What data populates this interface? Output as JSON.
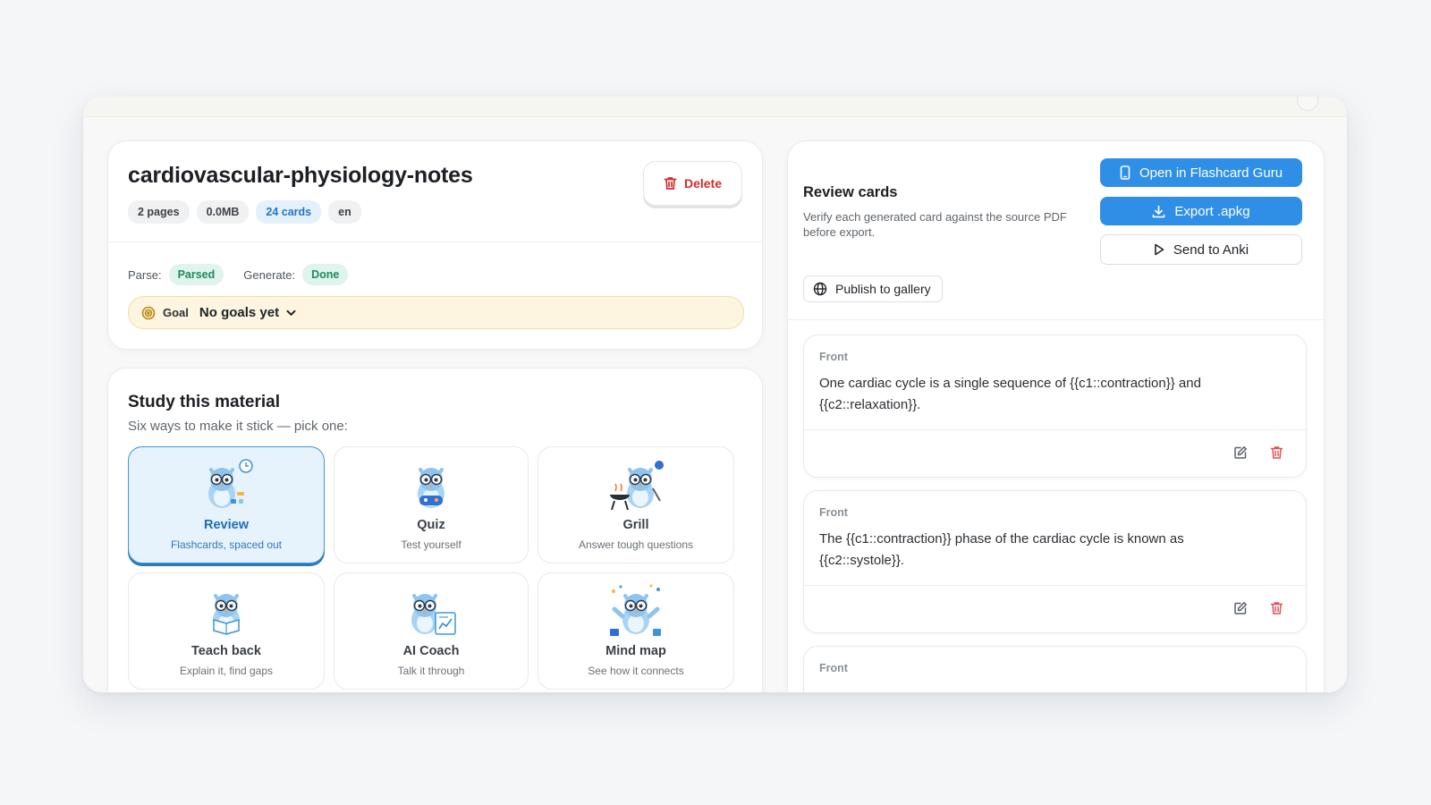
{
  "document": {
    "title": "cardiovascular-physiology-notes",
    "chips": [
      "2 pages",
      "0.0MB",
      "24 cards",
      "en"
    ],
    "delete_label": "Delete",
    "parse_label": "Parse:",
    "parse_status": "Parsed",
    "generate_label": "Generate:",
    "generate_status": "Done",
    "goal_label": "Goal",
    "goal_value": "No goals yet"
  },
  "study": {
    "title": "Study this material",
    "subtitle": "Six ways to make it stick — pick one:",
    "modes": [
      {
        "name": "Review",
        "desc": "Flashcards, spaced out",
        "active": true
      },
      {
        "name": "Quiz",
        "desc": "Test yourself",
        "active": false
      },
      {
        "name": "Grill",
        "desc": "Answer tough questions",
        "active": false
      },
      {
        "name": "Teach back",
        "desc": "Explain it, find gaps",
        "active": false
      },
      {
        "name": "AI Coach",
        "desc": "Talk it through",
        "active": false
      },
      {
        "name": "Mind map",
        "desc": "See how it connects",
        "active": false
      }
    ]
  },
  "review": {
    "title": "Review cards",
    "description": "Verify each generated card against the source PDF before export.",
    "open_label": "Open in Flashcard Guru",
    "export_label": "Export .apkg",
    "send_label": "Send to Anki",
    "publish_label": "Publish to gallery",
    "cards": [
      {
        "label": "Front",
        "text": "One cardiac cycle is a single sequence of {{c1::contraction}} and {{c2::relaxation}}."
      },
      {
        "label": "Front",
        "text": "The {{c1::contraction}} phase of the cardiac cycle is known as {{c2::systole}}."
      },
      {
        "label": "Front",
        "text": ""
      }
    ]
  },
  "colors": {
    "primary": "#2f8fe6",
    "danger": "#d42c2c",
    "success": "#1f8a5e",
    "goal_bg": "#fdf5df",
    "active_mode": "#e6f3fd"
  }
}
